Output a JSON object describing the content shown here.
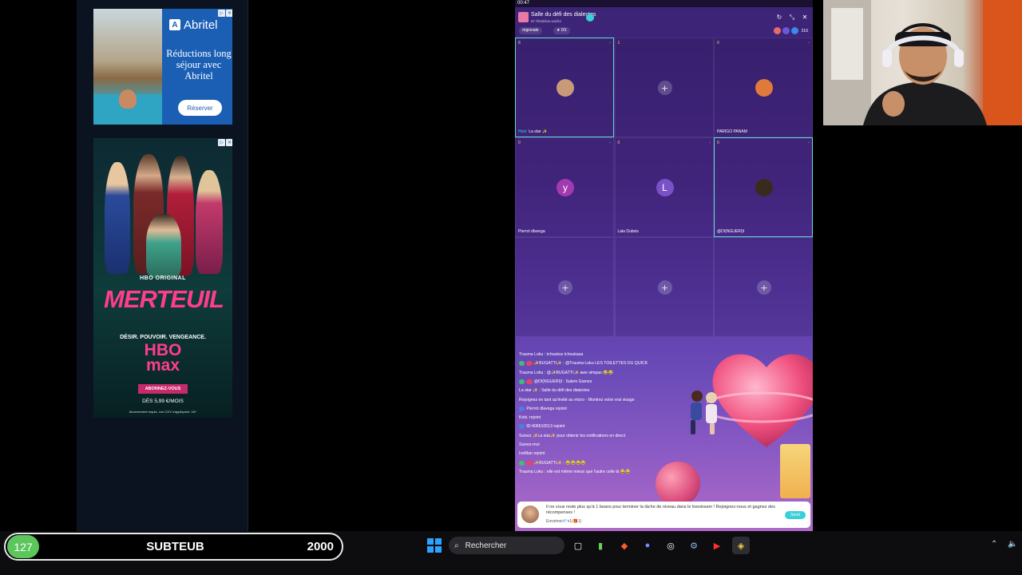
{
  "ads": {
    "abritel": {
      "brand": "Abritel",
      "text": "Réductions long séjour avec Abritel",
      "button": "Réserver"
    },
    "merteuil": {
      "hbo_original": "HBO ORIGINAL",
      "title": "MERTEUIL",
      "tagline": "DÉSIR. POUVOIR. VENGEANCE.",
      "hbo": "HBO",
      "max": "max",
      "subscribe": "ABONNEZ-VOUS",
      "price": "DÈS 5,99 €/MOIS",
      "legal": "Abonnement requis. Les CGV s'appliquent. 18+"
    }
  },
  "app": {
    "status_time": "00:47",
    "room_title": "Salle du défi des dialectes",
    "room_id": "ID Tiktoklive.wsd11",
    "tag_regionale": "régionale",
    "tag_count": "0/1",
    "viewer_count": "216",
    "seats": [
      {
        "num": "8",
        "name": "La star ✨",
        "avatar_letter": "",
        "avatar_color": "#c89a7a",
        "host": "Host",
        "state": "occupied",
        "active": true
      },
      {
        "num": "1",
        "name": "",
        "avatar_letter": "",
        "avatar_color": "",
        "host": "",
        "state": "empty",
        "active": false
      },
      {
        "num": "0",
        "name": "PARIGO PANAM",
        "avatar_letter": "",
        "avatar_color": "#e07a3a",
        "host": "",
        "state": "occupied",
        "active": false
      },
      {
        "num": "0",
        "name": "Pierrot dlavega",
        "avatar_letter": "y",
        "avatar_color": "#a23ab0",
        "host": "",
        "state": "occupied",
        "active": false
      },
      {
        "num": "0",
        "name": "Lala Dubois",
        "avatar_letter": "L",
        "avatar_color": "#7a52c8",
        "host": "",
        "state": "occupied",
        "active": false
      },
      {
        "num": "0",
        "name": "@DI(NGUERI)I",
        "avatar_letter": "",
        "avatar_color": "#3a2a1e",
        "host": "",
        "state": "occupied",
        "active": true
      },
      {
        "num": "",
        "name": "",
        "avatar_letter": "",
        "avatar_color": "",
        "host": "",
        "state": "empty",
        "active": false
      },
      {
        "num": "",
        "name": "",
        "avatar_letter": "",
        "avatar_color": "",
        "host": "",
        "state": "empty",
        "active": false
      },
      {
        "num": "",
        "name": "",
        "avatar_letter": "",
        "avatar_color": "",
        "host": "",
        "state": "empty",
        "active": false
      }
    ],
    "chat": [
      {
        "badges": [],
        "text": "Trauma Loku : tchoukss tchoukasa"
      },
      {
        "badges": [
          "g",
          "r"
        ],
        "text": "✨BUGATTI✨ : @Trauma Loku LES TOILETTES DU QUICK"
      },
      {
        "badges": [],
        "text": "Trauma Loku : @✨BUGATTI✨ awe simpas 😂😂"
      },
      {
        "badges": [
          "g",
          "r"
        ],
        "text": "@DI(NGUERI)I : Salem Games"
      },
      {
        "badges": [],
        "text": "La star ✨ : Salle du défi des dialectes"
      },
      {
        "badges": [],
        "text": "Rejoignez en tant qu'invité au micro - Montrez votre vrai visage"
      },
      {
        "badges": [
          "b"
        ],
        "text": "Pierrot dlavega rejoint"
      },
      {
        "badges": [],
        "text": "Koki. rejoint"
      },
      {
        "badges": [
          "b"
        ],
        "text": "ID:406510513 rejoint"
      },
      {
        "badges": [],
        "text": "Suivez ✨La star✨ pour obtenir les notifications en direct"
      },
      {
        "badges": [],
        "text": "Suivez-moi"
      },
      {
        "badges": [],
        "text": "IceMan rejoint"
      },
      {
        "badges": [
          "g",
          "r"
        ],
        "text": "✨BUGATTI✨ : 😂😂😂😂"
      },
      {
        "badges": [],
        "text": "Trauma Loku : elle est même mieux que l'autre celle là 😂😂"
      }
    ],
    "notification": {
      "text": "Il ne vous reste plus qu'à 1 beans pour terminer la tâche de niveau dans le livestream ! Rejoignez-nous et gagnez des récompenses !",
      "sub": "Envoimoi💎x1(🎁1)",
      "send": "Send"
    }
  },
  "scoreboard": {
    "level": "127",
    "name": "SUBTEUB",
    "value": "2000"
  },
  "taskbar": {
    "search_placeholder": "Rechercher"
  }
}
